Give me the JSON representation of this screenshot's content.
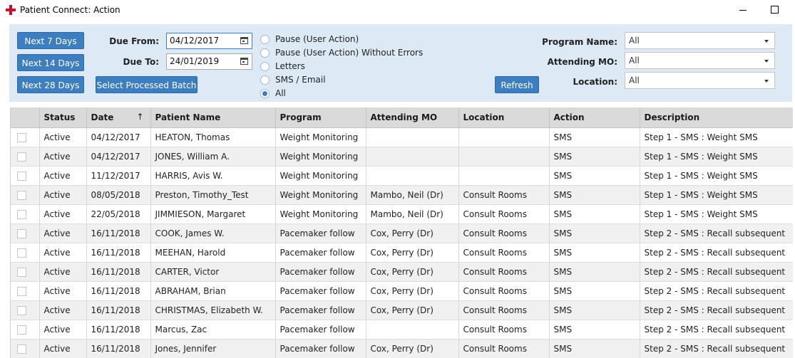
{
  "window": {
    "title": "Patient Connect: Action"
  },
  "filters": {
    "next7": "Next 7 Days",
    "next14": "Next 14 Days",
    "next28": "Next 28 Days",
    "select_batch": "Select Processed Batch",
    "refresh": "Refresh",
    "due_from_label": "Due From:",
    "due_from_value": "04/12/2017",
    "due_to_label": "Due To:",
    "due_to_value": "24/01/2019",
    "radios": [
      {
        "label": "Pause (User Action)",
        "checked": false
      },
      {
        "label": "Pause (User Action) Without Errors",
        "checked": false
      },
      {
        "label": "Letters",
        "checked": false
      },
      {
        "label": "SMS / Email",
        "checked": false
      },
      {
        "label": "All",
        "checked": true
      }
    ],
    "program_label": "Program Name:",
    "program_value": "All",
    "mo_label": "Attending MO:",
    "mo_value": "All",
    "location_label": "Location:",
    "location_value": "All"
  },
  "grid": {
    "columns": [
      "",
      "Status",
      "Date",
      "Patient Name",
      "Program",
      "Attending MO",
      "Location",
      "Action",
      "Description"
    ],
    "sort_indicator": "↑",
    "rows": [
      [
        "Active",
        "04/12/2017",
        "HEATON, Thomas",
        "Weight Monitoring",
        "",
        "",
        "SMS",
        "Step 1 - SMS : Weight SMS"
      ],
      [
        "Active",
        "04/12/2017",
        "JONES, William A.",
        "Weight Monitoring",
        "",
        "",
        "SMS",
        "Step 1 - SMS : Weight SMS"
      ],
      [
        "Active",
        "11/12/2017",
        "HARRIS, Avis W.",
        "Weight Monitoring",
        "",
        "",
        "SMS",
        "Step 1 - SMS : Weight SMS"
      ],
      [
        "Active",
        "08/05/2018",
        "Preston, Timothy_Test",
        "Weight Monitoring",
        "Mambo, Neil (Dr)",
        "Consult Rooms",
        "SMS",
        "Step 1 - SMS : Weight SMS"
      ],
      [
        "Active",
        "22/05/2018",
        "JIMMIESON, Margaret",
        "Weight Monitoring",
        "Mambo, Neil (Dr)",
        "Consult Rooms",
        "SMS",
        "Step 1 - SMS : Weight SMS"
      ],
      [
        "Active",
        "16/11/2018",
        "COOK, James W.",
        "Pacemaker follow",
        "Cox, Perry (Dr)",
        "Consult Rooms",
        "SMS",
        "Step 2 - SMS : Recall subsequent"
      ],
      [
        "Active",
        "16/11/2018",
        "MEEHAN, Harold",
        "Pacemaker follow",
        "Cox, Perry (Dr)",
        "Consult Rooms",
        "SMS",
        "Step 2 - SMS : Recall subsequent"
      ],
      [
        "Active",
        "16/11/2018",
        "CARTER, Victor",
        "Pacemaker follow",
        "Cox, Perry (Dr)",
        "Consult Rooms",
        "SMS",
        "Step 2 - SMS : Recall subsequent"
      ],
      [
        "Active",
        "16/11/2018",
        "ABRAHAM, Brian",
        "Pacemaker follow",
        "Cox, Perry (Dr)",
        "Consult Rooms",
        "SMS",
        "Step 2 - SMS : Recall subsequent"
      ],
      [
        "Active",
        "16/11/2018",
        "CHRISTMAS, Elizabeth W.",
        "Pacemaker follow",
        "Cox, Perry (Dr)",
        "Consult Rooms",
        "SMS",
        "Step 2 - SMS : Recall subsequent"
      ],
      [
        "Active",
        "16/11/2018",
        "Marcus, Zac",
        "Pacemaker follow",
        "",
        "Consult Rooms",
        "SMS",
        "Step 2 - SMS : Recall subsequent"
      ],
      [
        "Active",
        "16/11/2018",
        "Jones, Jennifer",
        "Pacemaker follow",
        "Cox, Perry (Dr)",
        "Consult Rooms",
        "SMS",
        "Step 2 - SMS : Recall subsequent"
      ]
    ]
  }
}
